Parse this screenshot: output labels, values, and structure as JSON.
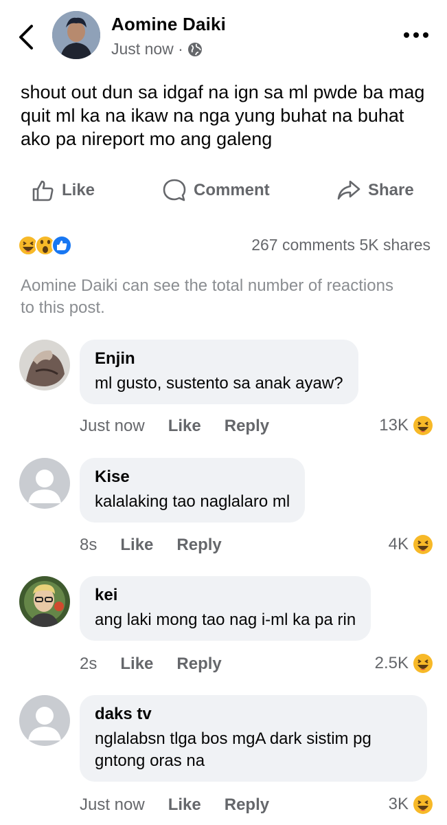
{
  "post": {
    "author": "Aomine Daiki",
    "time": "Just now ·",
    "text": "shout out dun sa idgaf na ign sa ml pwde ba mag quit ml ka na ikaw na nga yung buhat na buhat ako pa nireport mo ang galeng"
  },
  "actions": {
    "like": "Like",
    "comment": "Comment",
    "share": "Share"
  },
  "stats": {
    "counts": "267 comments 5K shares"
  },
  "note": "Aomine Daiki can see the total number of reactions to this post.",
  "comments": [
    {
      "name": "Enjin",
      "text": "ml gusto, sustento sa anak ayaw?",
      "time": "Just now",
      "like": "Like",
      "reply": "Reply",
      "reactions": "13K"
    },
    {
      "name": "Kise",
      "text": "kalalaking tao naglalaro ml",
      "time": "8s",
      "like": "Like",
      "reply": "Reply",
      "reactions": "4K"
    },
    {
      "name": "kei",
      "text": "ang laki mong tao nag i-ml ka pa rin",
      "time": "2s",
      "like": "Like",
      "reply": "Reply",
      "reactions": "2.5K"
    },
    {
      "name": "daks tv",
      "text": "nglalabsn tlga bos mgA dark sistim pg gntong oras na",
      "time": "Just now",
      "like": "Like",
      "reply": "Reply",
      "reactions": "3K"
    }
  ],
  "colors": {
    "meta": "#65676b",
    "bubble": "#f0f2f5",
    "like_blue": "#1877f2",
    "emoji_yellow": "#f7b928"
  },
  "icons": [
    "back-chevron-icon",
    "globe-icon",
    "more-dots-icon",
    "like-thumb-icon",
    "comment-bubble-icon",
    "share-arrow-icon",
    "haha-emoji-icon",
    "wow-emoji-icon",
    "like-reaction-icon"
  ]
}
